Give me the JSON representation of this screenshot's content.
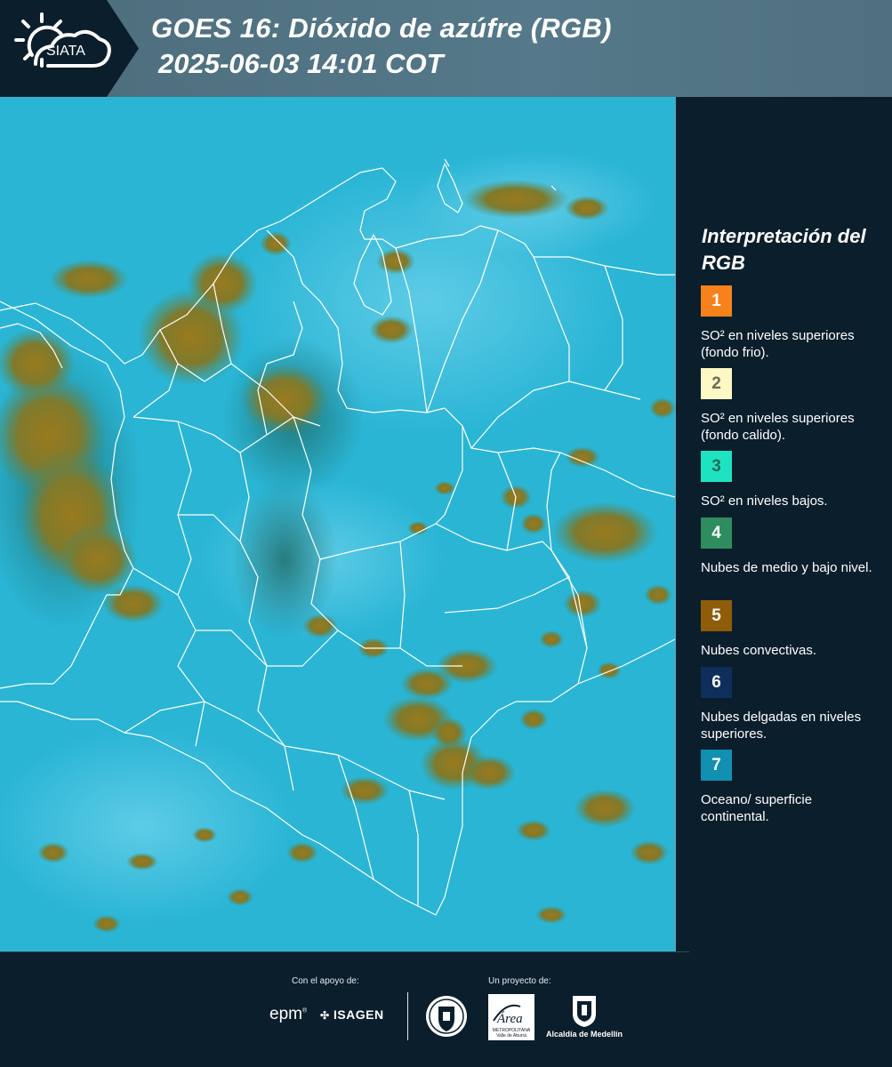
{
  "header": {
    "logo_text": "SIATA",
    "title_line1": "GOES 16: Dióxido de azúfre (RGB)",
    "title_line2": "2025-06-03 14:01 COT"
  },
  "legend": {
    "title": "Interpretación del RGB",
    "items": [
      {
        "number": "1",
        "color": "#f7821b",
        "text": "SO² en niveles superiores (fondo frio)."
      },
      {
        "number": "2",
        "color": "#fef8c4",
        "text": "SO² en niveles superiores (fondo calido)."
      },
      {
        "number": "3",
        "color": "#1ee3c0",
        "text": "SO² en niveles bajos."
      },
      {
        "number": "4",
        "color": "#2f8c5f",
        "text": "Nubes de medio y bajo nivel."
      },
      {
        "number": "5",
        "color": "#8f5c0a",
        "text": "Nubes convectivas."
      },
      {
        "number": "6",
        "color": "#0f2e5c",
        "text": "Nubes delgadas en niveles superiores."
      },
      {
        "number": "7",
        "color": "#1290b2",
        "text": "Oceano/ superficie continental."
      }
    ]
  },
  "footer": {
    "support_label": "Con el apoyo de:",
    "project_label": "Un proyecto de:",
    "sponsor1": "epm",
    "sponsor2": "ISAGEN",
    "area_logo_text": "Área",
    "area_logo_sub": "METROPOLITANA Valle de Aburrá",
    "alcaldia": "Alcaldía de Medellín"
  },
  "colors": {
    "background": "#0b1e2c",
    "header_band": "#55798a",
    "map_base": "#2ab6d6",
    "cloud": "#8a7a2c",
    "border": "#ffffff"
  }
}
